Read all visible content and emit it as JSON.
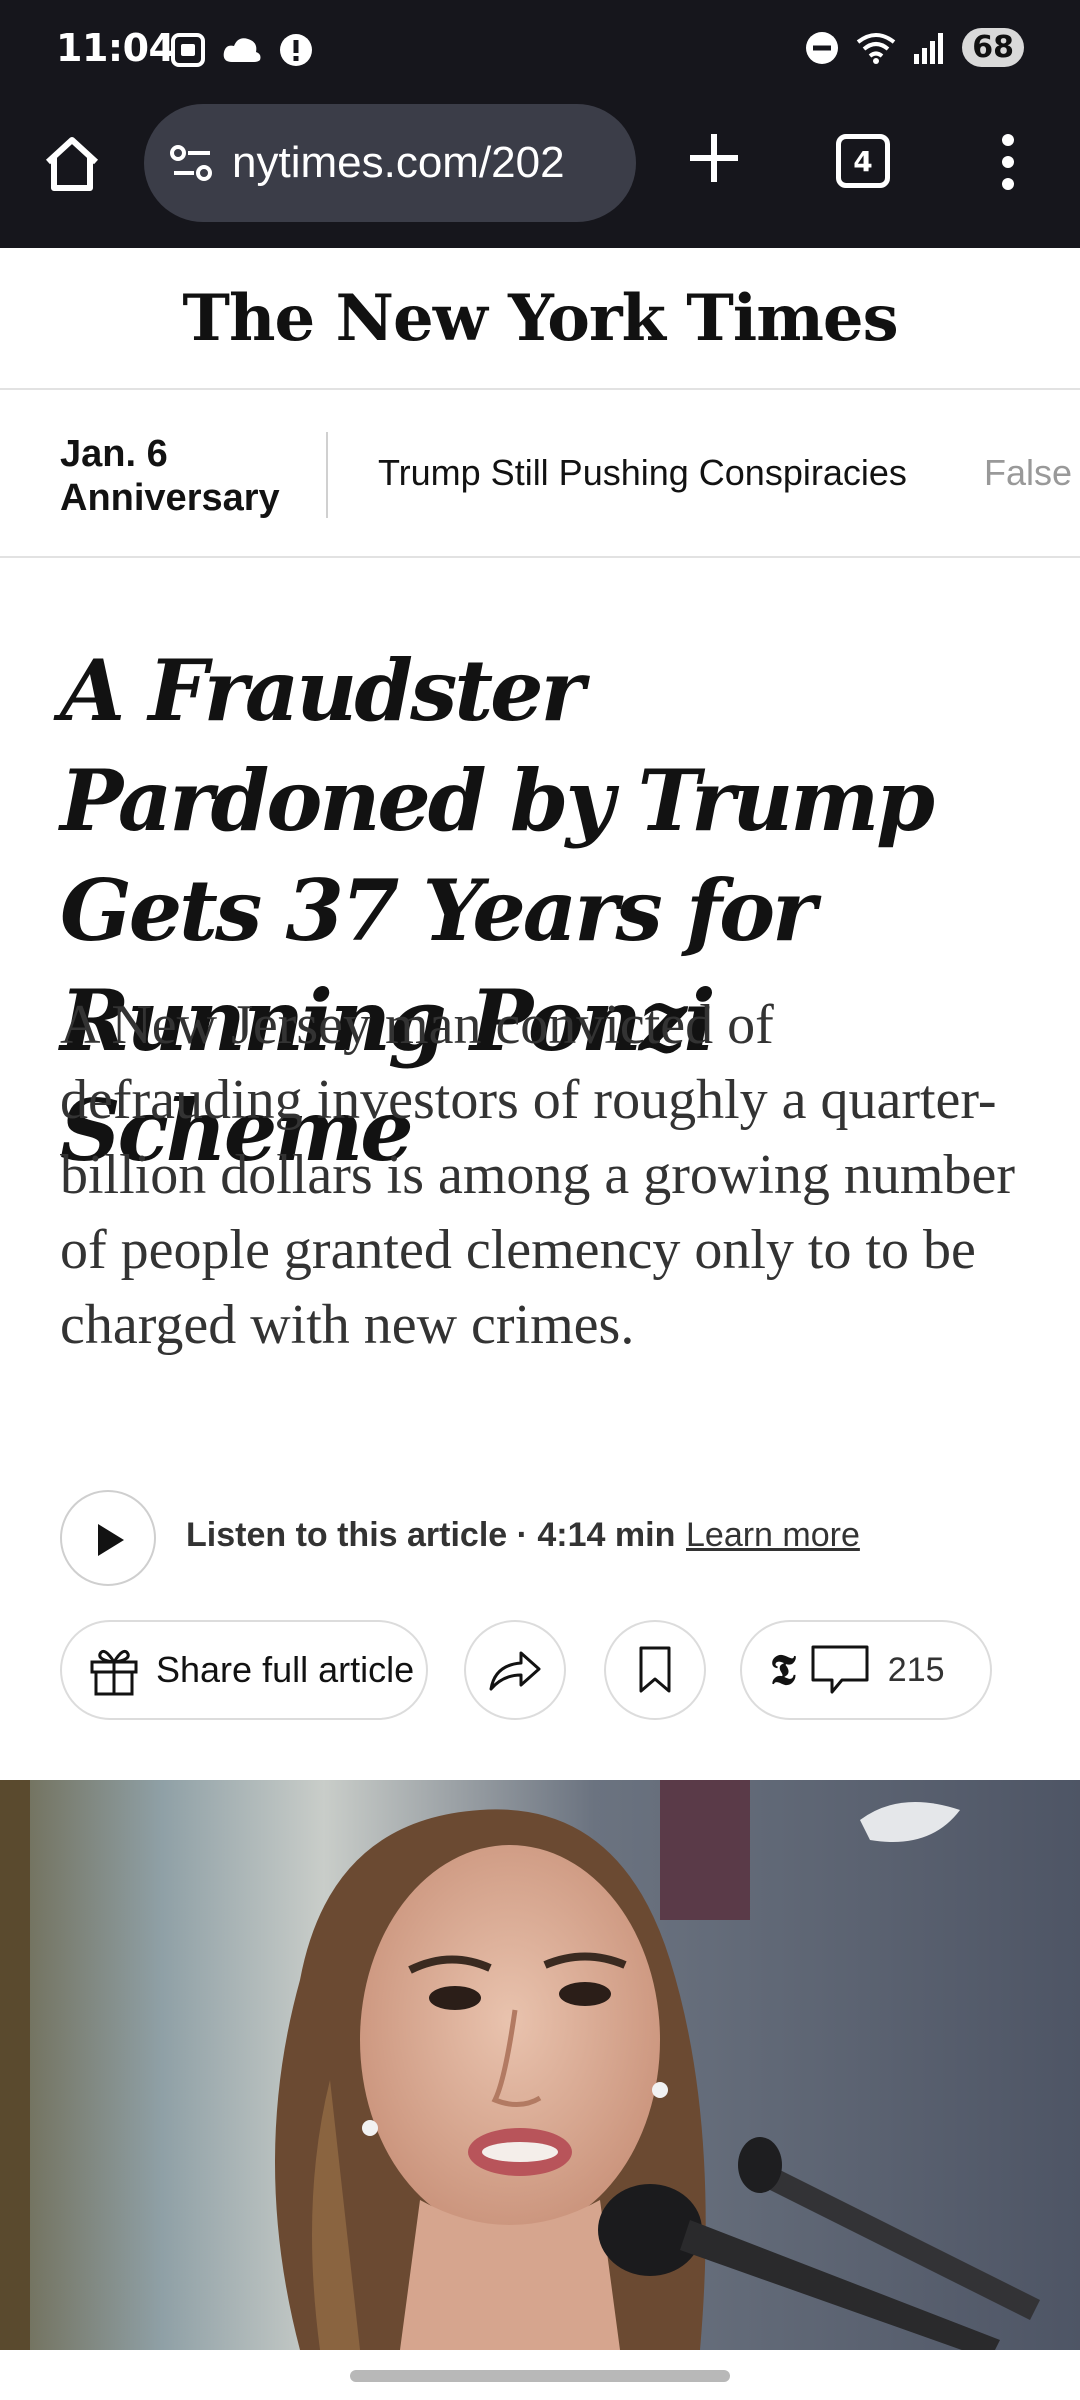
{
  "status_bar": {
    "time": "11:04",
    "battery": "68",
    "icons": [
      "screenshot-icon",
      "cloud-icon",
      "alert-icon",
      "do-not-disturb-icon",
      "wifi-icon",
      "signal-icon"
    ]
  },
  "browser": {
    "url": "nytimes.com/202",
    "tab_count": "4",
    "icons": [
      "home-icon",
      "site-info-icon",
      "new-tab-icon",
      "menu-icon"
    ]
  },
  "masthead": {
    "logo": "The New York Times"
  },
  "nav": {
    "kicker_line1": "Jan. 6",
    "kicker_line2": "Anniversary",
    "link1": "Trump Still Pushing Conspiracies",
    "link2": "False"
  },
  "article": {
    "headline": "A Fraudster Pardoned by Trump Gets 37 Years for Running Ponzi Scheme",
    "summary": "A New Jersey man convicted of defrauding investors of roughly a quarter-billion dollars is among a growing number of people granted clemency only to to be charged with new crimes.",
    "listen_text": "Listen to this article · 4:14 min",
    "learn_more": "Learn more",
    "share_label": "Share full article",
    "comment_count": "215",
    "t_logo": "𝕿"
  },
  "colors": {
    "chrome_bg": "#16161c",
    "url_bar_bg": "#3b3d48",
    "text_primary": "#121212"
  }
}
